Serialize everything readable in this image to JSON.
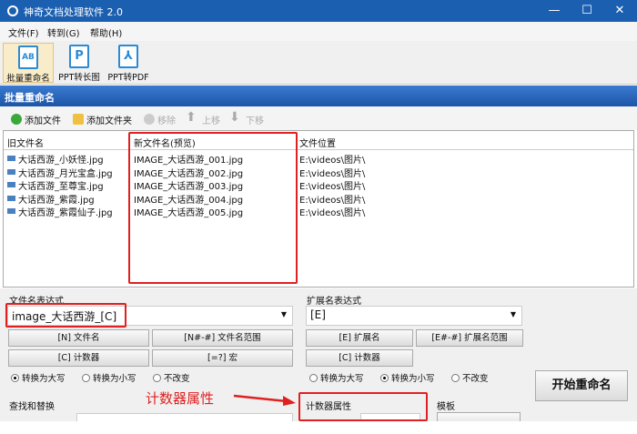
{
  "window": {
    "title": "神奇文档处理软件 2.0",
    "min": "—",
    "max": "☐",
    "close": "✕"
  },
  "menu": [
    "文件(F)",
    "转到(G)",
    "帮助(H)"
  ],
  "toolbar": [
    {
      "label": "批量重命名",
      "icon": "AB"
    },
    {
      "label": "PPT转长图",
      "icon": "P"
    },
    {
      "label": "PPT转PDF",
      "icon": "⅄"
    }
  ],
  "section_title": "批量重命名",
  "actions": {
    "add_file": "添加文件",
    "add_folder": "添加文件夹",
    "remove": "移除",
    "up": "上移",
    "down": "下移"
  },
  "table": {
    "headers": [
      "旧文件名",
      "新文件名(预览)",
      "文件位置"
    ],
    "rows": [
      [
        "大话西游_小妖怪.jpg",
        "IMAGE_大话西游_001.jpg",
        "E:\\videos\\图片\\"
      ],
      [
        "大话西游_月光宝盒.jpg",
        "IMAGE_大话西游_002.jpg",
        "E:\\videos\\图片\\"
      ],
      [
        "大话西游_至尊宝.jpg",
        "IMAGE_大话西游_003.jpg",
        "E:\\videos\\图片\\"
      ],
      [
        "大话西游_紫霞.jpg",
        "IMAGE_大话西游_004.jpg",
        "E:\\videos\\图片\\"
      ],
      [
        "大话西游_紫霞仙子.jpg",
        "IMAGE_大话西游_005.jpg",
        "E:\\videos\\图片\\"
      ]
    ]
  },
  "name_expr": {
    "label": "文件名表达式",
    "value": "image_大话西游_[C]",
    "buttons": [
      "[N] 文件名",
      "[N#-#] 文件名范围",
      "[C] 计数器",
      "[=?] 宏"
    ],
    "radios": [
      "转换为大写",
      "转换为小写",
      "不改变"
    ]
  },
  "ext_expr": {
    "label": "扩展名表达式",
    "value": "[E]",
    "buttons": [
      "[E] 扩展名",
      "[E#-#] 扩展名范围",
      "[C] 计数器"
    ],
    "radios": [
      "转换为大写",
      "转换为小写",
      "不改变"
    ]
  },
  "start_button": "开始重命名",
  "find_replace": "查找和替换",
  "annotation": "计数器属性",
  "counter_props": "计数器属性",
  "template": "模板"
}
